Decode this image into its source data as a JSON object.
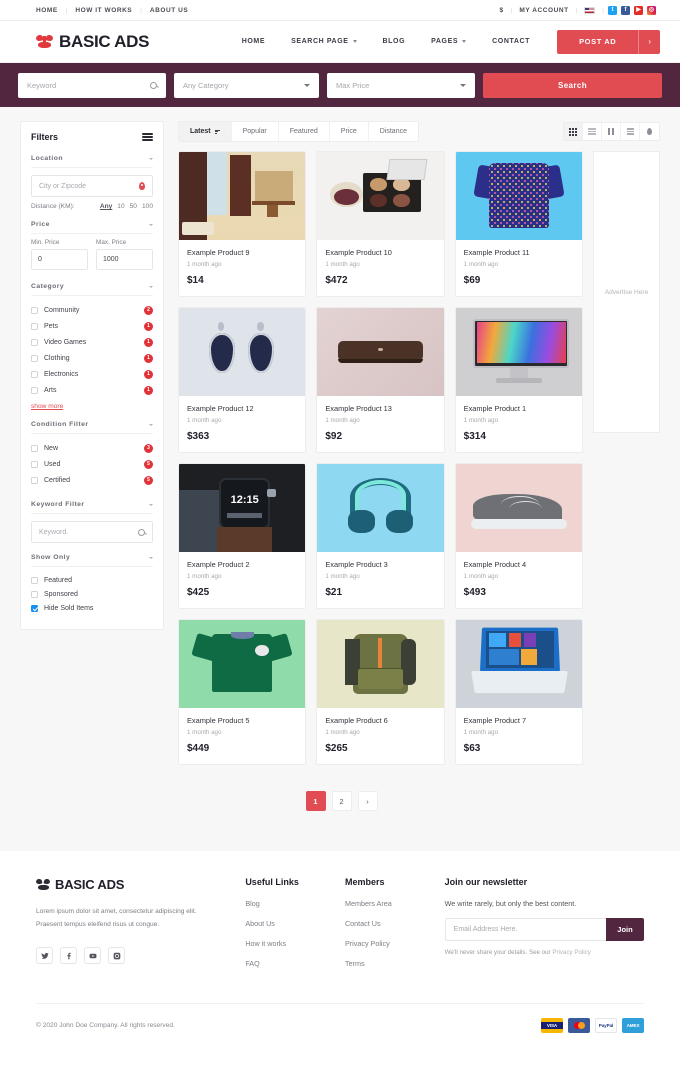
{
  "topbar": {
    "links": [
      "HOME",
      "HOW IT WORKS",
      "ABOUT US"
    ],
    "currency": "$",
    "account": "MY ACCOUNT",
    "flag_icon": "us-flag-icon",
    "social": [
      {
        "name": "twitter-icon",
        "glyph": "t"
      },
      {
        "name": "facebook-icon",
        "glyph": "f"
      },
      {
        "name": "youtube-icon",
        "glyph": "▶"
      },
      {
        "name": "instagram-icon",
        "glyph": "◎"
      }
    ]
  },
  "header": {
    "brand": "BASIC ADS",
    "nav": [
      {
        "label": "HOME",
        "dropdown": false
      },
      {
        "label": "SEARCH PAGE",
        "dropdown": true
      },
      {
        "label": "BLOG",
        "dropdown": false
      },
      {
        "label": "PAGES",
        "dropdown": true
      },
      {
        "label": "CONTACT",
        "dropdown": false
      }
    ],
    "post_ad_label": "POST AD",
    "post_ad_arrow": "›"
  },
  "searchbar": {
    "keyword_placeholder": "Keyword",
    "category_value": "Any Category",
    "price_value": "Max Price",
    "search_label": "Search",
    "bg_color": "#52263f",
    "accent_color": "#e14b52"
  },
  "sidebar": {
    "title": "Filters",
    "location": {
      "heading": "Location",
      "placeholder": "City or Zipcode",
      "distance_label": "Distance (KM):",
      "distance_options": [
        "Any",
        "10",
        "50",
        "100"
      ],
      "distance_active": "Any"
    },
    "price": {
      "heading": "Price",
      "min_label": "Min. Price",
      "min_value": "0",
      "max_label": "Max. Price",
      "max_value": "1000"
    },
    "category": {
      "heading": "Category",
      "items": [
        {
          "label": "Community",
          "count": "2",
          "checked": false
        },
        {
          "label": "Pets",
          "count": "1",
          "checked": false
        },
        {
          "label": "Video Games",
          "count": "1",
          "checked": false
        },
        {
          "label": "Clothing",
          "count": "1",
          "checked": false
        },
        {
          "label": "Electronics",
          "count": "1",
          "checked": false
        },
        {
          "label": "Arts",
          "count": "1",
          "checked": false
        }
      ],
      "show_more": "show more"
    },
    "condition": {
      "heading": "Condition Filter",
      "items": [
        {
          "label": "New",
          "count": "3",
          "checked": false
        },
        {
          "label": "Used",
          "count": "5",
          "checked": false
        },
        {
          "label": "Certified",
          "count": "5",
          "checked": false
        }
      ]
    },
    "keyword_filter": {
      "heading": "Keyword Filter",
      "placeholder": "Keyword."
    },
    "show_only": {
      "heading": "Show Only",
      "items": [
        {
          "label": "Featured",
          "checked": false
        },
        {
          "label": "Sponsored",
          "checked": false
        },
        {
          "label": "Hide Sold Items",
          "checked": true
        }
      ]
    }
  },
  "toolbar": {
    "sort_tabs": [
      {
        "label": "Latest",
        "active": true,
        "has_icon": true
      },
      {
        "label": "Popular",
        "active": false,
        "has_icon": false
      },
      {
        "label": "Featured",
        "active": false,
        "has_icon": false
      },
      {
        "label": "Price",
        "active": false,
        "has_icon": false
      },
      {
        "label": "Distance",
        "active": false,
        "has_icon": false
      }
    ],
    "view_modes": [
      {
        "name": "grid-view-icon",
        "active": true
      },
      {
        "name": "rows-view-icon",
        "active": false
      },
      {
        "name": "columns-view-icon",
        "active": false
      },
      {
        "name": "list-view-icon",
        "active": false
      },
      {
        "name": "map-view-icon",
        "active": false
      }
    ]
  },
  "products": [
    {
      "title": "Example Product 9",
      "date": "1 month ago",
      "price": "$14",
      "img": "room-interior"
    },
    {
      "title": "Example Product 10",
      "date": "1 month ago",
      "price": "$472",
      "img": "makeup-palette"
    },
    {
      "title": "Example Product 11",
      "date": "1 month ago",
      "price": "$69",
      "img": "floral-dress"
    },
    {
      "title": "Example Product 12",
      "date": "1 month ago",
      "price": "$363",
      "img": "earrings"
    },
    {
      "title": "Example Product 13",
      "date": "1 month ago",
      "price": "$92",
      "img": "air-conditioner"
    },
    {
      "title": "Example Product 1",
      "date": "1 month ago",
      "price": "$314",
      "img": "imac-monitor"
    },
    {
      "title": "Example Product 2",
      "date": "1 month ago",
      "price": "$425",
      "img": "smartwatch"
    },
    {
      "title": "Example Product 3",
      "date": "1 month ago",
      "price": "$21",
      "img": "headphones"
    },
    {
      "title": "Example Product 4",
      "date": "1 month ago",
      "price": "$493",
      "img": "sneaker"
    },
    {
      "title": "Example Product 5",
      "date": "1 month ago",
      "price": "$449",
      "img": "soccer-jersey"
    },
    {
      "title": "Example Product 6",
      "date": "1 month ago",
      "price": "$265",
      "img": "backpack"
    },
    {
      "title": "Example Product 7",
      "date": "1 month ago",
      "price": "$63",
      "img": "laptop"
    }
  ],
  "ad": {
    "label": "Advertise Here"
  },
  "pagination": {
    "pages": [
      "1",
      "2"
    ],
    "active": "1",
    "next": "›"
  },
  "footer": {
    "brand": "BASIC ADS",
    "desc_line1": "Lorem ipsum dolor sit amet, consectetur adipiscing elit.",
    "desc_line2": "Praesent tempus eleifend risus ut congue.",
    "social": [
      "twitter-icon",
      "facebook-icon",
      "youtube-icon",
      "instagram-icon"
    ],
    "useful_links": {
      "title": "Useful Links",
      "items": [
        "Blog",
        "About Us",
        "How it works",
        "FAQ"
      ]
    },
    "members": {
      "title": "Members",
      "items": [
        "Members Area",
        "Contact Us",
        "Privacy Policy",
        "Terms"
      ]
    },
    "newsletter": {
      "title": "Join our newsletter",
      "subtitle": "We write rarely, but only the best content.",
      "placeholder": "Email Address Here.",
      "button": "Join",
      "note": "We'll never share your details. See our ",
      "note_link": "Privacy Policy"
    },
    "copyright": "© 2020 John Doe Company. All rights reserved.",
    "payments": [
      "VISA",
      "MC",
      "PayPal",
      "AMEX"
    ]
  }
}
